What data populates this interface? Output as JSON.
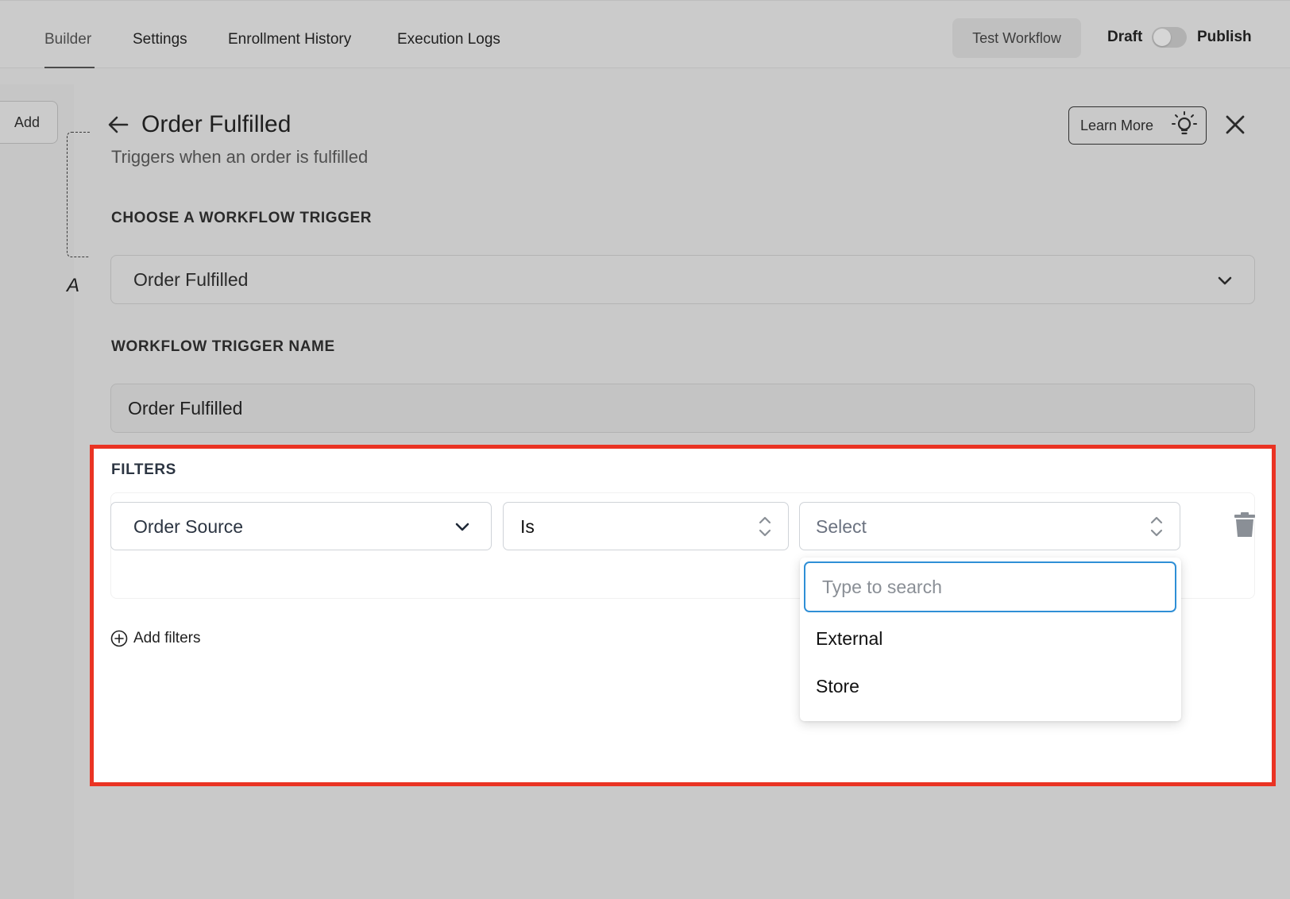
{
  "nav": {
    "tabs": [
      {
        "label": "Builder",
        "active": true
      },
      {
        "label": "Settings",
        "active": false
      },
      {
        "label": "Enrollment History",
        "active": false
      },
      {
        "label": "Execution Logs",
        "active": false
      }
    ],
    "test_workflow_label": "Test Workflow",
    "draft_label": "Draft",
    "publish_label": "Publish",
    "published": false
  },
  "left": {
    "add_label": "Add",
    "partial_letter": "A"
  },
  "panel": {
    "title": "Order Fulfilled",
    "subtitle": "Triggers when an order is fulfilled",
    "learn_more_label": "Learn More",
    "trigger_section_label": "CHOOSE A WORKFLOW TRIGGER",
    "trigger_value": "Order Fulfilled",
    "name_section_label": "WORKFLOW TRIGGER NAME",
    "name_value": "Order Fulfilled"
  },
  "filters": {
    "section_label": "FILTERS",
    "field_value": "Order Source",
    "operator_value": "Is",
    "value_placeholder": "Select",
    "dropdown": {
      "search_placeholder": "Type to search",
      "options": [
        "External",
        "Store"
      ]
    },
    "add_filters_label": "Add filters"
  },
  "colors": {
    "highlight_border": "#ea3323",
    "focus_ring": "#2f8fd6",
    "overlay_gray": "#c9c9c9"
  },
  "icons": [
    "arrow-left-icon",
    "lightbulb-icon",
    "close-icon",
    "chevron-down-icon",
    "updown-chevron-icon",
    "trash-icon",
    "plus-circle-icon"
  ]
}
